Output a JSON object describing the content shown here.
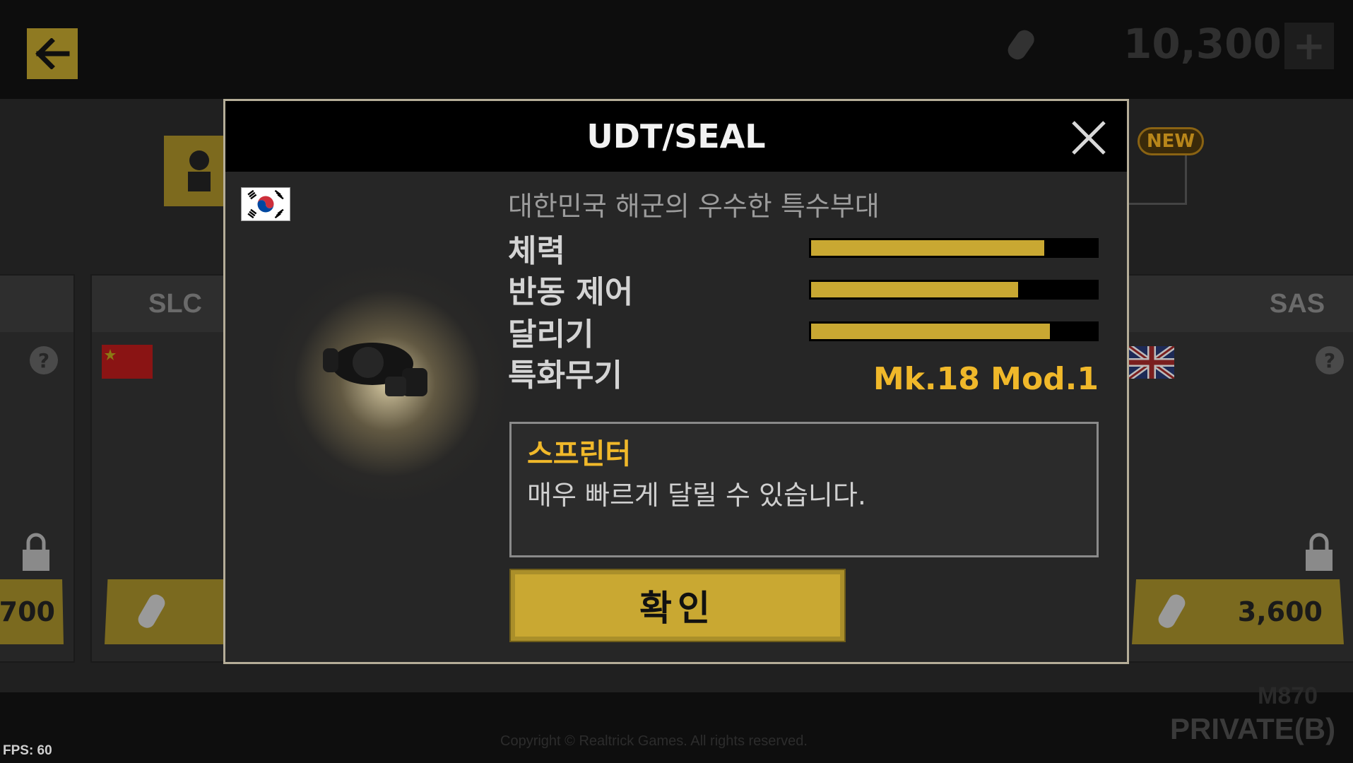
{
  "header": {
    "currency_amount": "10,300",
    "currency_plus": "+",
    "new_badge": "NEW"
  },
  "cards": [
    {
      "price": "700"
    },
    {
      "name": "SLC",
      "flag": "china-flag"
    },
    {
      "name": "SAS",
      "flag": "uk-flag",
      "price": "3,600"
    }
  ],
  "card_help_glyph": "?",
  "footer": {
    "fps": "FPS: 60",
    "copyright": "Copyright © Realtrick Games. All rights reserved.",
    "rank": "PRIVATE(B)",
    "weapon": "M870"
  },
  "modal": {
    "title": "UDT/SEAL",
    "subtitle": "대한민국 해군의 우수한 특수부대",
    "flag": "south-korea-flag",
    "stats": [
      {
        "label": "체력",
        "level": 0.82
      },
      {
        "label": "반동 제어",
        "level": 0.73
      },
      {
        "label": "달리기",
        "level": 0.84
      }
    ],
    "weapon_label": "특화무기",
    "weapon_value": "Mk.18 Mod.1",
    "skill_name": "스프린터",
    "skill_desc": "매우 빠르게 달릴 수 있습니다.",
    "confirm_label": "확인"
  },
  "colors": {
    "accent_yellow": "#c9a832",
    "highlight_orange": "#f0b82a",
    "modal_border": "#b5ad98"
  }
}
